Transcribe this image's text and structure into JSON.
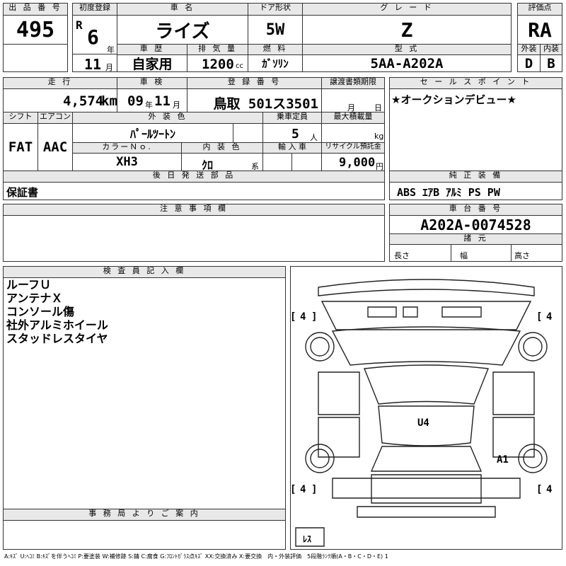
{
  "header": {
    "lot_no_label": "出 品 番 号",
    "lot_no": "495",
    "first_reg_label": "初度登録",
    "era": "R",
    "year": "6",
    "year_unit": "年",
    "month": "11",
    "month_unit": "月",
    "car_name_label": "車 名",
    "car_name": "ライズ",
    "door_label": "ドア形状",
    "door": "5W",
    "grade_label": "グ レ ー ド",
    "grade": "Z",
    "eval_label": "評価点",
    "eval": "RA",
    "history_label": "車 歴",
    "history": "自家用",
    "displacement_label": "排 気 量",
    "displacement": "1200",
    "displacement_unit": "cc",
    "fuel_label": "燃 料",
    "fuel": "ｶﾞｿﾘﾝ",
    "model_label": "型 式",
    "model": "5AA-A202A",
    "exterior_label": "外装",
    "exterior": "D",
    "interior_label": "内装",
    "interior": "B"
  },
  "row2": {
    "mileage_label": "走 行",
    "mileage": "4,574",
    "mileage_unit": "km",
    "inspection_label": "車 検",
    "insp_year": "09",
    "insp_year_unit": "年",
    "insp_month": "11",
    "insp_month_unit": "月",
    "reg_no_label": "登 録 番 号",
    "reg_no": "鳥取 501ス3501",
    "transfer_label": "譲渡書類期限",
    "transfer_month_unit": "月",
    "transfer_day_unit": "日",
    "sales_point_label": "セ ー ル ス ポ イ ン ト",
    "sales_point": "★オークションデビュー★"
  },
  "row3": {
    "shift_label": "シフト",
    "shift": "FAT",
    "ac_label": "エアコン",
    "ac": "AAC",
    "color_label": "外 装 色",
    "color": "ﾊﾟｰﾙﾂｰﾄﾝ",
    "capacity_label": "乗車定員",
    "capacity": "5",
    "capacity_unit": "人",
    "load_label": "最大積載量",
    "load_unit": "kg",
    "color_no_label": "カラーＮｏ.",
    "color_no": "XH3",
    "int_color_label": "内 装 色",
    "int_color": "ｸﾛ",
    "int_color_unit": "系",
    "import_label": "輸 入 車",
    "recycle_label": "リサイクル預託金",
    "recycle": "9,000",
    "recycle_unit": "円"
  },
  "later_parts": {
    "label": "後 日 発 送 部 品",
    "value": "保証書"
  },
  "equipment": {
    "label": "純 正 装 備",
    "value": "ABS ｴｱB ｱﾙﾐ PS PW"
  },
  "notes": {
    "label": "注 意 事 項 欄"
  },
  "chassis": {
    "label": "車 台 番 号",
    "value": "A202A-0074528",
    "specs_label": "諸 元",
    "length_label": "長さ",
    "width_label": "幅",
    "height_label": "高さ"
  },
  "inspector": {
    "label": "検 査 員 記 入 欄",
    "lines": [
      "ルーフＵ",
      "アンテナＸ",
      "コンソール傷",
      "社外アルミホイール",
      "スタッドレスタイヤ"
    ]
  },
  "office": {
    "label": "事 務 局 よ り ご 案 内"
  },
  "diagram": {
    "tire_fl": "4",
    "tire_fr": "4",
    "tire_rl": "4",
    "tire_rr": "4",
    "mark_roof": "U4",
    "mark_rear_right": "A1",
    "spare": "ﾚｽ"
  },
  "legend": "A:ｷｽﾞ U:ﾍｺﾐ B:ｷｽﾞを伴うﾍｺﾐ P:要塗装 W:補修跡 S:錆 C:腐食 G:ﾌﾛﾝﾄｶﾞﾗｽ点ｷｽﾞ XX:交換済み X:要交換　内・外装評価　5段階ﾗﾝｸ順(A・B・C・D・E) 1"
}
